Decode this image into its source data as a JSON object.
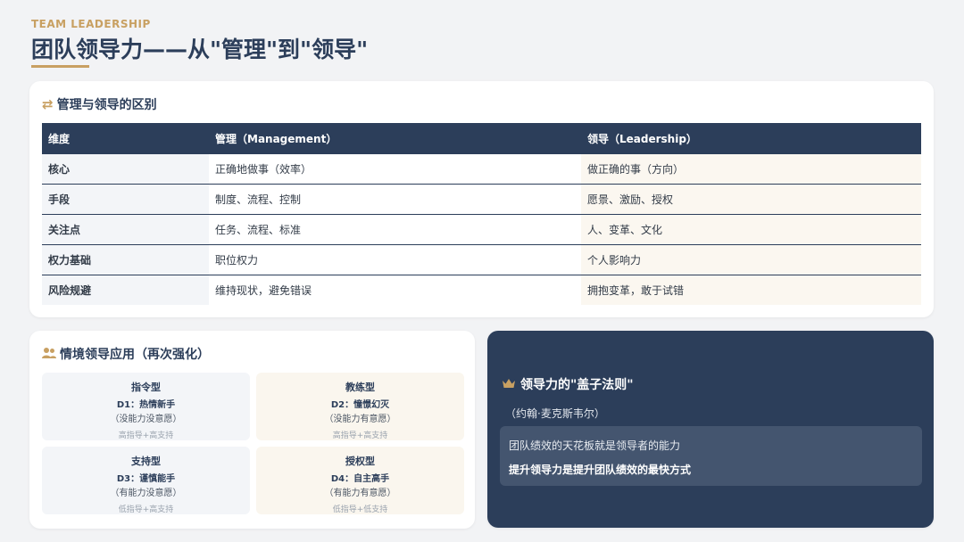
{
  "header": {
    "eyebrow": "TEAM LEADERSHIP",
    "title": "团队领导力——从\"管理\"到\"领导\""
  },
  "comparison": {
    "title": "管理与领导的区别",
    "icon": "swap-arrows-icon",
    "columns": [
      "维度",
      "管理（Management）",
      "领导（Leadership）"
    ],
    "rows": [
      [
        "核心",
        "正确地做事（效率）",
        "做正确的事（方向）"
      ],
      [
        "手段",
        "制度、流程、控制",
        "愿景、激励、授权"
      ],
      [
        "关注点",
        "任务、流程、标准",
        "人、变革、文化"
      ],
      [
        "权力基础",
        "职位权力",
        "个人影响力"
      ],
      [
        "风险规避",
        "维持现状，避免错误",
        "拥抱变革，敢于试错"
      ]
    ]
  },
  "situational": {
    "title": "情境领导应用（再次强化）",
    "icon": "users-icon",
    "quadrants": [
      {
        "name": "指令型",
        "stage": "D1：热情新手",
        "desc": "（没能力没意愿）",
        "style": "高指导+高支持"
      },
      {
        "name": "教练型",
        "stage": "D2：憧憬幻灭",
        "desc": "（没能力有意愿）",
        "style": "高指导+高支持"
      },
      {
        "name": "支持型",
        "stage": "D3：谨慎能手",
        "desc": "（有能力没意愿）",
        "style": "低指导+高支持"
      },
      {
        "name": "授权型",
        "stage": "D4：自主高手",
        "desc": "（有能力有意愿）",
        "style": "低指导+低支持"
      }
    ]
  },
  "law": {
    "icon": "crown-icon",
    "title": "领导力的\"盖子法则\"",
    "author": "（约翰·麦克斯韦尔）",
    "line1": "团队绩效的天花板就是领导者的能力",
    "line2": "提升领导力是提升团队绩效的最快方式"
  },
  "colors": {
    "navy": "#2c3e5a",
    "gold": "#c8a062",
    "warm": "#faf6ee"
  }
}
